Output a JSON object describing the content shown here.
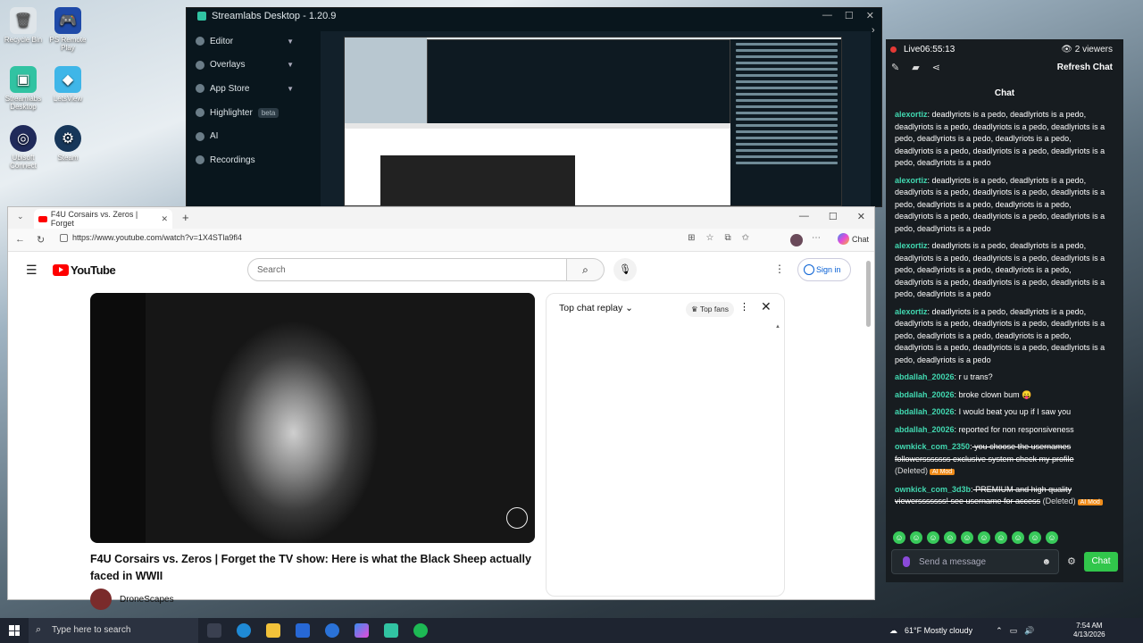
{
  "desktop": {
    "icons": [
      {
        "label": "Recycle Bin"
      },
      {
        "label": "PS Remote Play"
      },
      {
        "label": "Streamlabs Desktop"
      },
      {
        "label": "LetsView"
      },
      {
        "label": "Ubisoft Connect"
      },
      {
        "label": "Steam"
      }
    ]
  },
  "streamlabs": {
    "title": "Streamlabs Desktop - 1.20.9",
    "nav": [
      {
        "label": "Editor"
      },
      {
        "label": "Overlays"
      },
      {
        "label": "App Store"
      },
      {
        "label": "Highlighter",
        "badge": "beta"
      },
      {
        "label": "AI"
      },
      {
        "label": "Recordings"
      }
    ]
  },
  "live": {
    "status": "Live",
    "timer": "06:55:13",
    "viewers": "2 viewers",
    "refresh_label": "Refresh Chat",
    "chat_heading": "Chat",
    "messages": [
      {
        "user": "alexortiz",
        "text": " deadlyriots is a pedo, deadlyriots is a pedo, deadlyriots is a pedo, deadlyriots is a pedo, deadlyriots is a pedo, deadlyriots is a pedo, deadlyriots is a pedo, deadlyriots is a pedo, deadlyriots is a pedo, deadlyriots is a pedo, deadlyriots is a pedo"
      },
      {
        "user": "alexortiz",
        "text": " deadlyriots is a pedo, deadlyriots is a pedo, deadlyriots is a pedo, deadlyriots is a pedo, deadlyriots is a pedo, deadlyriots is a pedo, deadlyriots is a pedo, deadlyriots is a pedo, deadlyriots is a pedo, deadlyriots is a pedo, deadlyriots is a pedo"
      },
      {
        "user": "alexortiz",
        "text": " deadlyriots is a pedo, deadlyriots is a pedo, deadlyriots is a pedo, deadlyriots is a pedo, deadlyriots is a pedo, deadlyriots is a pedo, deadlyriots is a pedo, deadlyriots is a pedo, deadlyriots is a pedo, deadlyriots is a pedo, deadlyriots is a pedo"
      },
      {
        "user": "alexortiz",
        "text": " deadlyriots is a pedo, deadlyriots is a pedo, deadlyriots is a pedo, deadlyriots is a pedo, deadlyriots is a pedo, deadlyriots is a pedo, deadlyriots is a pedo, deadlyriots is a pedo, deadlyriots is a pedo, deadlyriots is a pedo, deadlyriots is a pedo"
      },
      {
        "user": "abdallah_20026",
        "text": " r u trans?"
      },
      {
        "user": "abdallah_20026",
        "text": " broke clown bum 😛"
      },
      {
        "user": "abdallah_20026",
        "text": " I would beat you up if I saw you"
      },
      {
        "user": "abdallah_20026",
        "text": " reported for non responsiveness"
      }
    ],
    "deleted_messages": [
      {
        "user": "ownkick_com_2350",
        "text": " you choose the usernames followersssssss exclusive system check my profile",
        "deleted": "(Deleted)",
        "badge": "AI Mod"
      },
      {
        "user": "ownkick_com_3d3b",
        "text": " PREMIUM and high quality viewersssssss! see username for access",
        "deleted": "(Deleted)",
        "badge": "AI Mod"
      }
    ],
    "input_placeholder": "Send a message",
    "chat_button": "Chat"
  },
  "browser": {
    "tab_title": "F4U Corsairs vs. Zeros | Forget",
    "url": "https://www.youtube.com/watch?v=1X4STla9fl4",
    "copilot_label": "Chat"
  },
  "youtube": {
    "logo": "YouTube",
    "search_placeholder": "Search",
    "signin": "Sign in",
    "video_title": "F4U Corsairs vs. Zeros | Forget the TV show: Here is what the Black Sheep actually faced in WWII",
    "channel": "DroneScapes",
    "chat_replay_label": "Top chat replay",
    "top_fans": "Top fans"
  },
  "taskbar": {
    "search_placeholder": "Type here to search",
    "weather": "61°F  Mostly cloudy",
    "time": "7:54 AM",
    "date": "4/13/2026"
  }
}
